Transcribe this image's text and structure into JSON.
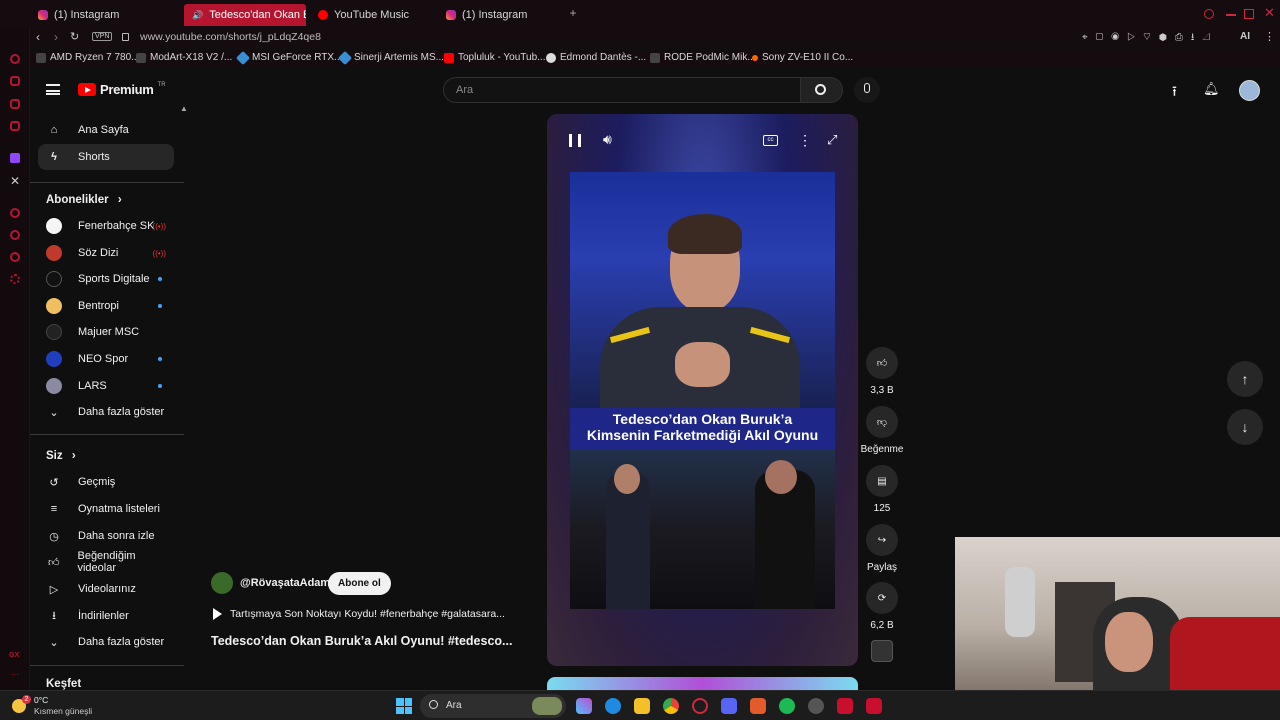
{
  "tabs": [
    {
      "label": "(1) Instagram"
    },
    {
      "label": "Tedesco'dan Okan Bu"
    },
    {
      "label": "YouTube Music"
    },
    {
      "label": "(1) Instagram"
    }
  ],
  "address": {
    "vpn": "VPN",
    "url": "www.youtube.com/shorts/j_pLdqZ4qe8"
  },
  "bookmarks": [
    "AMD Ryzen 7 780...",
    "ModArt-X18 V2 /...",
    "MSI GeForce RTX...",
    "Sinerji Artemis MS...",
    "Topluluk - YouTub...",
    "Edmond Dantès -...",
    "RODE PodMic Mik...",
    "Sony ZV-E10 II Co..."
  ],
  "header": {
    "logo": "Premium",
    "region": "TR",
    "search_placeholder": "Ara"
  },
  "sidebar": {
    "main": [
      {
        "label": "Ana Sayfa"
      },
      {
        "label": "Shorts"
      }
    ],
    "subs_title": "Abonelikler",
    "subs": [
      {
        "label": "Fenerbahçe SK",
        "color": "#f5f5f5"
      },
      {
        "label": "Söz Dizi",
        "color": "#c0392b"
      },
      {
        "label": "Sports Digitale",
        "color": "#111111"
      },
      {
        "label": "Bentropi",
        "color": "#f0c060"
      },
      {
        "label": "Majuer MSC",
        "color": "#222222"
      },
      {
        "label": "NEO Spor",
        "color": "#1f3fbf"
      },
      {
        "label": "LARS",
        "color": "#8a8aa0"
      }
    ],
    "show_more": "Daha fazla göster",
    "you_title": "Siz",
    "you": [
      {
        "label": "Geçmiş"
      },
      {
        "label": "Oynatma listeleri"
      },
      {
        "label": "Daha sonra izle"
      },
      {
        "label": "Beğendiğim videolar"
      },
      {
        "label": "Videolarınız"
      },
      {
        "label": "İndirilenler"
      }
    ],
    "show_more2": "Daha fazla göster",
    "explore_title": "Keşfet"
  },
  "short": {
    "channel": "@RövaşataAdam",
    "subscribe": "Abone ol",
    "desc": "Tartışmaya Son Noktayı Koydu! #fenerbahçe #galatasara...",
    "title": "Tedesco’dan Okan Buruk’a Akıl Oyunu! #tedesco...",
    "overlay_line1": "Tedesco’dan Okan Buruk’a",
    "overlay_line2": "Kimsenin Farketmediği Akıl Oyunu",
    "likes": "3,3 B",
    "dislike": "Beğenme",
    "comments": "125",
    "share": "Paylaş",
    "remix": "6,2 B"
  },
  "weather": {
    "temp": "0°C",
    "desc": "Kısmen güneşli",
    "badge": "2"
  },
  "taskbar": {
    "search": "Ara"
  }
}
